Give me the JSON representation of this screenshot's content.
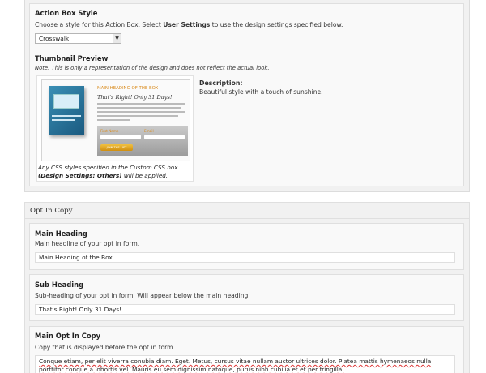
{
  "action_box_style": {
    "title": "Action Box Style",
    "description_prefix": "Choose a style for this Action Box. Select ",
    "description_bold": "User Settings",
    "description_suffix": " to use the design settings specified below.",
    "selected_style": "Crosswalk"
  },
  "thumbnail_preview": {
    "title": "Thumbnail Preview",
    "note": "Note: This is only a representation of the design and does not reflect the actual look.",
    "image_heading": "MAIN HEADING OF THE BOX",
    "image_subheading": "That's Right! Only 31 Days!",
    "image_first_name_label": "First Name",
    "image_email_label": "Email",
    "image_button_label": "JOIN THE LIST",
    "caption_prefix": "Any CSS styles specified in the Custom CSS box",
    "caption_bold": "(Design Settings: Others)",
    "caption_suffix": " will be applied."
  },
  "description": {
    "label": "Description:",
    "text": "Beautiful style with a touch of sunshine."
  },
  "opt_in_copy": {
    "section_title": "Opt In Copy",
    "main_heading": {
      "title": "Main Heading",
      "description": "Main headline of your opt in form.",
      "value": "Main Heading of the Box"
    },
    "sub_heading": {
      "title": "Sub Heading",
      "description": "Sub-heading of your opt in form. Will appear below the main heading.",
      "value": "That's Right! Only 31 Days!"
    },
    "main_opt_in_copy": {
      "title": "Main Opt In Copy",
      "description": "Copy that is displayed before the opt in form.",
      "value": "Conque etiam, per elit viverra conubia diam. Eget. Metus, cursus vitae nullam auctor ultrices dolor. Platea mattis hymenaeos nulla porttitor conque a lobortis vel. Mauris eu sem dignissim natoque, purus nibh cubilia et et per fringilla."
    }
  }
}
